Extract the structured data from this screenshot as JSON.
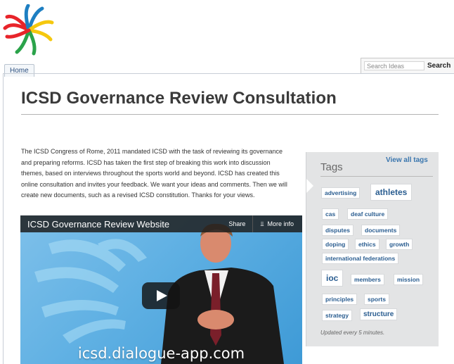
{
  "nav": {
    "home_tab": "Home"
  },
  "search": {
    "placeholder": "Search Ideas",
    "button_label": "Search"
  },
  "page": {
    "title": "ICSD Governance Review Consultation",
    "intro": "The ICSD Congress of Rome, 2011 mandated ICSD with the task of reviewing its governance and preparing reforms. ICSD has taken the first step of breaking this work into discussion themes, based on interviews throughout the sports world and beyond. ICSD has created this online consultation and invites your feedback.  We want your ideas and comments.  Then we will create new documents, such as a revised ICSD constitution. Thanks for your views."
  },
  "video": {
    "title": "ICSD Governance Review Website",
    "share_label": "Share",
    "more_info_label": "More info",
    "overlay_url": "icsd.dialogue-app.com"
  },
  "tags": {
    "heading": "Tags",
    "view_all": "View all tags",
    "items": [
      "advertising",
      "athletes",
      "cas",
      "deaf culture",
      "disputes",
      "documents",
      "doping",
      "ethics",
      "growth",
      "international federations",
      "ioc",
      "members",
      "mission",
      "principles",
      "sports",
      "strategy",
      "structure"
    ],
    "updated_note": "Updated every 5 minutes."
  },
  "colors": {
    "link": "#3a76ae",
    "tag_text": "#2a5d90",
    "panel_bg": "#e3e4e5",
    "video_bg": "#5fb0e3"
  },
  "icons": [
    "icsd-logo",
    "play-icon",
    "more-info-arrows-icon"
  ]
}
